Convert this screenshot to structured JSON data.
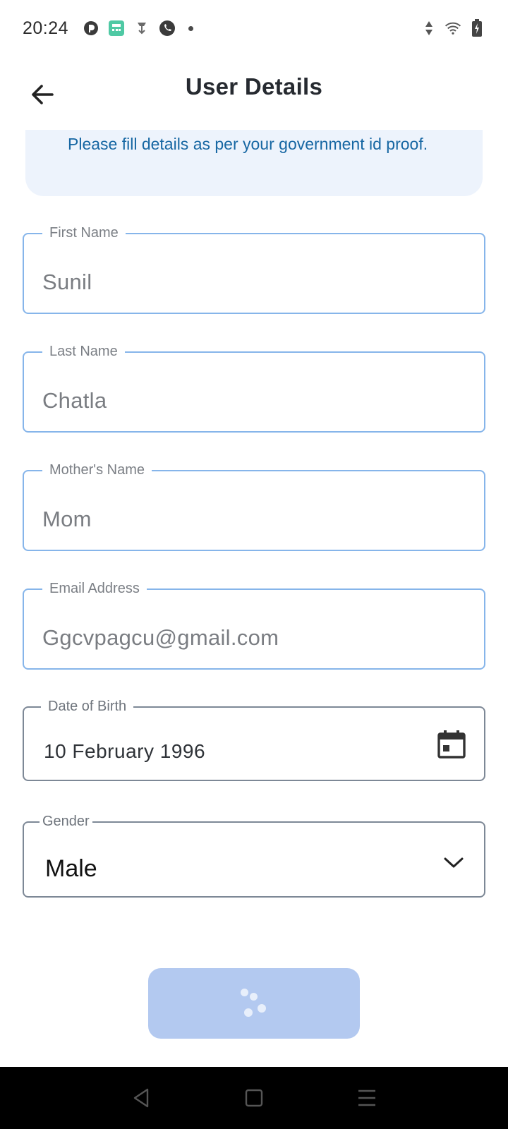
{
  "status_bar": {
    "time": "20:24",
    "icons": [
      "pocket-casts-icon",
      "calculator-app-icon",
      "download-notification-icon",
      "phone-call-icon",
      "more-dot-icon"
    ],
    "right_icons": [
      "data-arrows-icon",
      "wifi-icon",
      "battery-charging-icon"
    ]
  },
  "header": {
    "title": "User Details",
    "back_icon": "arrow-left-icon"
  },
  "info_banner": {
    "text": "Please fill details as per your government id proof."
  },
  "form": {
    "first_name": {
      "label": "First Name",
      "value": "Sunil"
    },
    "last_name": {
      "label": "Last Name",
      "value": "Chatla"
    },
    "mothers_name": {
      "label": "Mother's Name",
      "value": "Mom"
    },
    "email": {
      "label": "Email Address",
      "value": "Ggcvpagcu@gmail.com"
    },
    "dob": {
      "label": "Date of Birth",
      "value": "10 February 1996",
      "icon": "calendar-icon"
    },
    "gender": {
      "label": "Gender",
      "value": "Male",
      "icon": "chevron-down-icon"
    }
  },
  "submit": {
    "state": "loading",
    "icon": "loading-spinner-icon"
  },
  "nav_bar": {
    "buttons": [
      "back-triangle-icon",
      "home-square-icon",
      "recents-menu-icon"
    ]
  },
  "colors": {
    "accent_border": "#86b5ea",
    "banner_bg": "#edf3fc",
    "banner_text": "#1767a3",
    "button_loading_bg": "#b3c9f0"
  }
}
